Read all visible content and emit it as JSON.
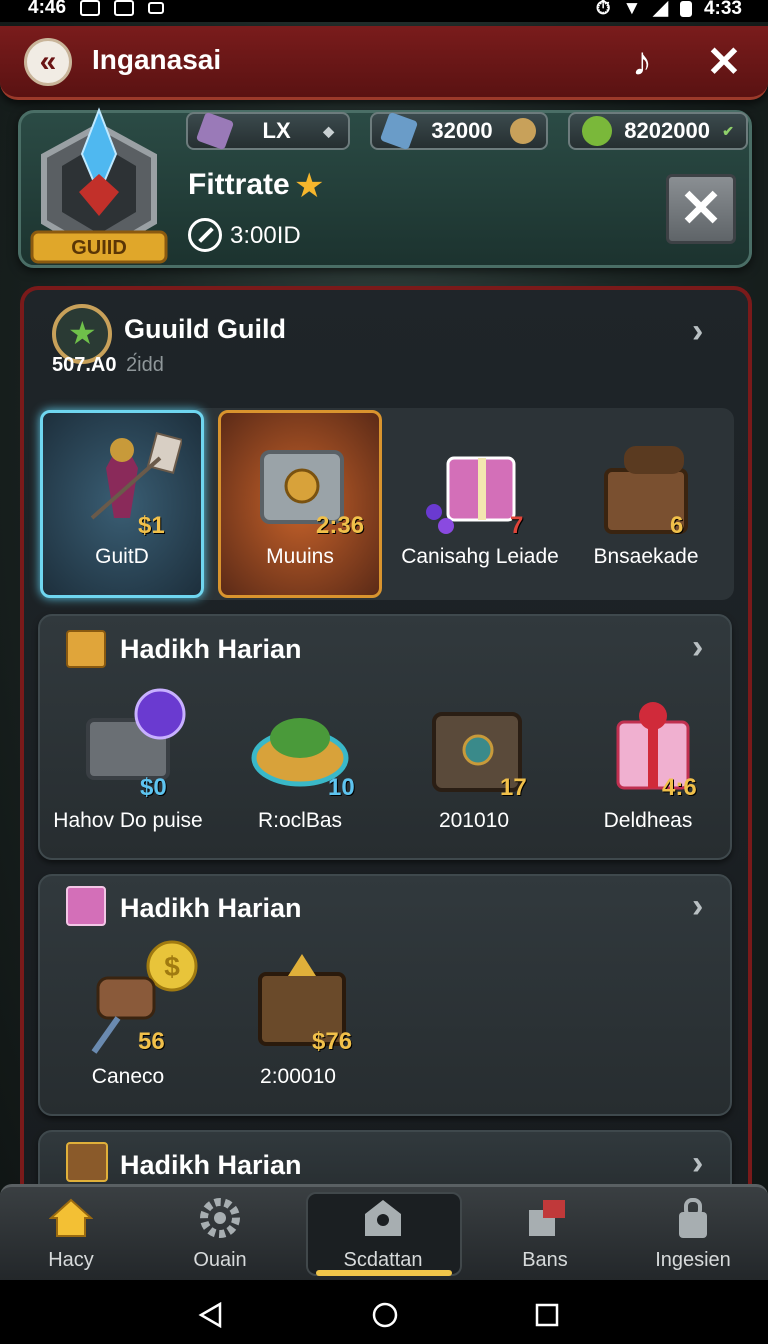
{
  "status_bar": {
    "time_left": "4:46",
    "time_right": "4:33"
  },
  "header": {
    "title": "Inganasai"
  },
  "guild_panel": {
    "emblem_label": "GUIID",
    "resources": [
      {
        "value": "LX",
        "icon": "crystal-icon",
        "color": "#9a7ab8"
      },
      {
        "value": "32000",
        "icon": "gem-icon",
        "color": "#6a9cc8"
      },
      {
        "value": "8202000",
        "icon": "leaf-gem-icon",
        "color": "#7ab83a"
      }
    ],
    "name": "Fittrate",
    "timer": "3:00ID"
  },
  "guild_section": {
    "title": "Guuild Guild",
    "sub_value": "507.A0",
    "sub_label": "2́idd",
    "items": [
      {
        "label": "GuitD",
        "badge": "$1"
      },
      {
        "label": "Muuins",
        "badge": "2:36"
      },
      {
        "label": "Canisahg Leiade",
        "badge": "7"
      },
      {
        "label": "Bnsaekade",
        "badge": "6"
      }
    ]
  },
  "sections": [
    {
      "title": "Hadikh Harian",
      "items": [
        {
          "label": "Hahov Do puise",
          "badge": "$0"
        },
        {
          "label": "R:oclBas",
          "badge": "10"
        },
        {
          "label": "201010",
          "badge": "17"
        },
        {
          "label": "Deldheas",
          "badge": "4:6"
        }
      ]
    },
    {
      "title": "Hadikh Harian",
      "items": [
        {
          "label": "Caneco",
          "badge": "56"
        },
        {
          "label": "2:00010",
          "badge": "$76"
        }
      ]
    },
    {
      "title": "Hadikh Harian",
      "items": []
    }
  ],
  "bottom_nav": [
    {
      "label": "Hacy",
      "icon": "home-icon"
    },
    {
      "label": "Ouain",
      "icon": "gear-icon"
    },
    {
      "label": "Scdattan",
      "icon": "shop-icon"
    },
    {
      "label": "Bans",
      "icon": "flag-icon"
    },
    {
      "label": "Ingesien",
      "icon": "lock-icon"
    }
  ]
}
